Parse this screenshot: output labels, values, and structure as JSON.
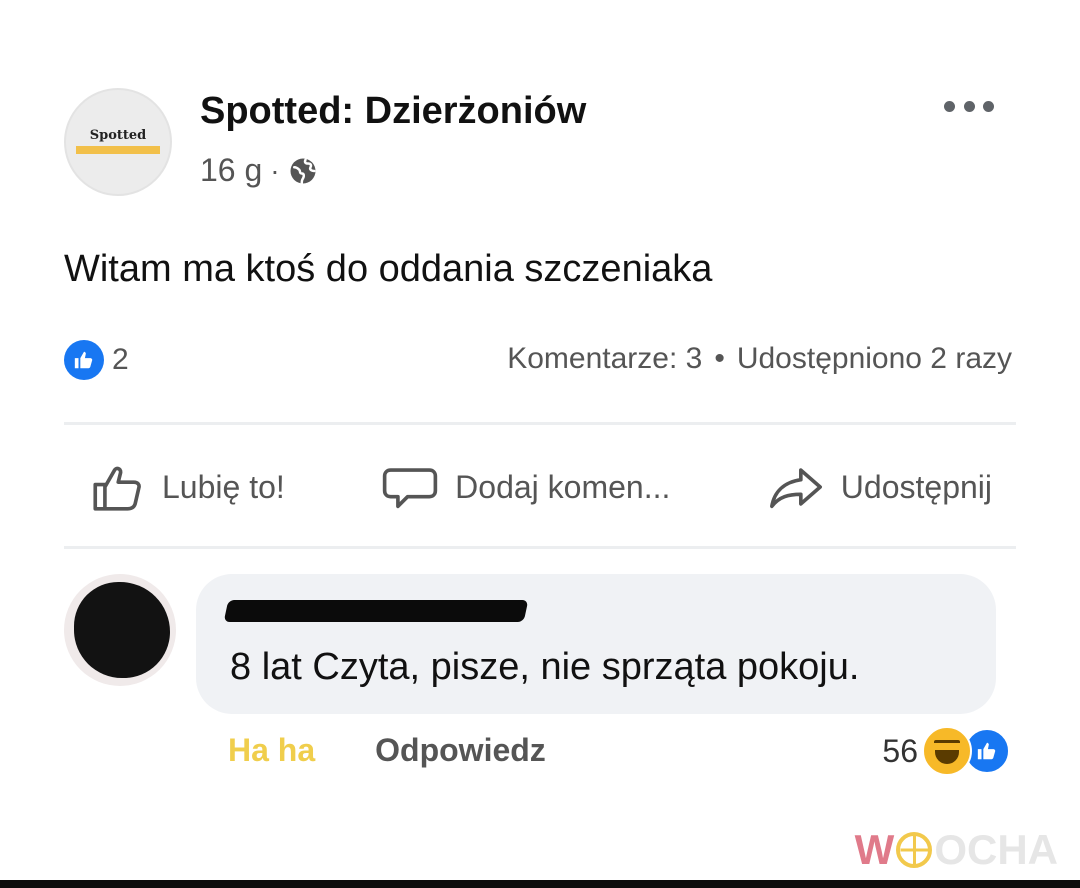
{
  "post": {
    "avatar_logo_text": "Spotted",
    "page_name": "Spotted: Dzierżoniów",
    "time": "16 g",
    "separator": "·",
    "privacy_icon": "globe-icon",
    "more_icon": "more-horizontal-icon",
    "text": "Witam ma ktoś do oddania szczeniaka"
  },
  "stats": {
    "reaction_icon": "like-icon",
    "reaction_count": "2",
    "comments": "Komentarze: 3",
    "dot": "•",
    "shares": "Udostępniono 2 razy"
  },
  "actions": {
    "like": {
      "label": "Lubię to!",
      "icon": "thumbs-up-outline-icon"
    },
    "comment": {
      "label": "Dodaj komen...",
      "icon": "speech-bubble-icon"
    },
    "share": {
      "label": "Udostępnij",
      "icon": "share-arrow-icon"
    }
  },
  "comment": {
    "author_redacted": true,
    "text": "8 lat Czyta, pisze, nie sprząta pokoju.",
    "react_label": "Ha ha",
    "reply_label": "Odpowiedz",
    "reaction_count": "56",
    "reaction_icons": [
      "haha-icon",
      "like-icon"
    ]
  },
  "colors": {
    "facebook_blue": "#1877f2",
    "haha_yellow": "#f0ce4c",
    "secondary_text": "#555555",
    "bubble_bg": "#f0f2f5"
  },
  "watermark": {
    "first_letter": "W",
    "wheel_icon": "wheel-icon",
    "rest": "OCHA"
  }
}
